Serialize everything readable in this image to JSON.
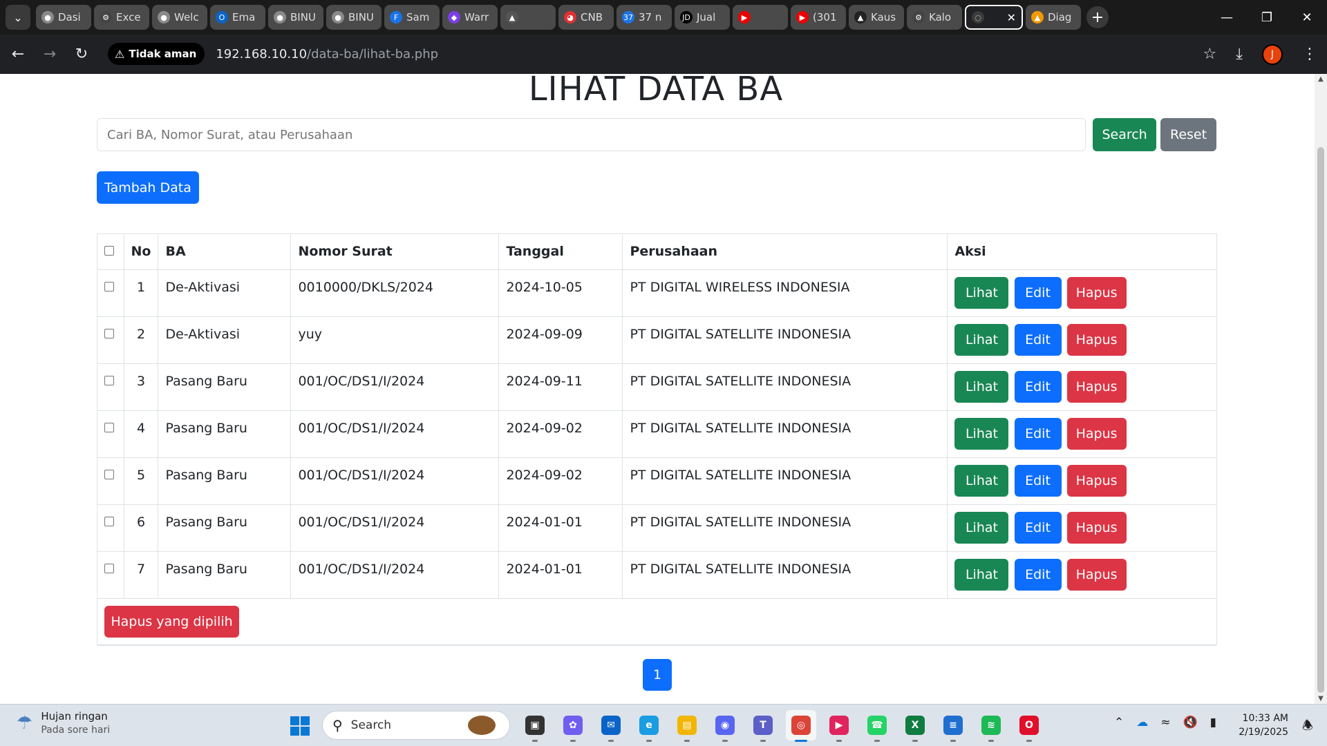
{
  "browser": {
    "tabs": [
      {
        "label": "Dasi",
        "color": "#8a8a8a",
        "glyph": "●"
      },
      {
        "label": "Exce",
        "color": "#444",
        "glyph": "⚙"
      },
      {
        "label": "Welc",
        "color": "#8a8a8a",
        "glyph": "●"
      },
      {
        "label": "Ema",
        "color": "#0a64c8",
        "glyph": "O"
      },
      {
        "label": "BINU",
        "color": "#8a8a8a",
        "glyph": "●"
      },
      {
        "label": "BINU",
        "color": "#8a8a8a",
        "glyph": "●"
      },
      {
        "label": "Sam",
        "color": "#1a73e8",
        "glyph": "F"
      },
      {
        "label": "Warr",
        "color": "#7b3fe4",
        "glyph": "◆"
      },
      {
        "label": "",
        "color": "#555",
        "glyph": "▲"
      },
      {
        "label": "CNB",
        "color": "#d33",
        "glyph": "◕"
      },
      {
        "label": "37 n",
        "color": "#1a73e8",
        "glyph": "37"
      },
      {
        "label": "Jual",
        "color": "#000",
        "glyph": "JD"
      },
      {
        "label": "",
        "color": "#e00",
        "glyph": "▶"
      },
      {
        "label": "(301",
        "color": "#e00",
        "glyph": "▶"
      },
      {
        "label": "Kaus",
        "color": "#222",
        "glyph": "▲"
      },
      {
        "label": "Kalo",
        "color": "#444",
        "glyph": "⚙"
      }
    ],
    "active_tab": {
      "label": "",
      "glyph": "◌"
    },
    "last_tab": {
      "label": "Diag",
      "color": "#f29900",
      "glyph": "▲"
    },
    "security_label": "Tidak aman",
    "url_host": "192.168.10.10",
    "url_path": "/data-ba/lihat-ba.php",
    "profile_initial": "J"
  },
  "page": {
    "title": "LIHAT DATA BA",
    "search": {
      "placeholder": "Cari BA, Nomor Surat, atau Perusahaan",
      "search_label": "Search",
      "reset_label": "Reset"
    },
    "add_label": "Tambah Data",
    "table": {
      "headers": {
        "no": "No",
        "ba": "BA",
        "nomor": "Nomor Surat",
        "tanggal": "Tanggal",
        "perusahaan": "Perusahaan",
        "aksi": "Aksi"
      },
      "rows": [
        {
          "no": "1",
          "ba": "De-Aktivasi",
          "nomor": "0010000/DKLS/2024",
          "tanggal": "2024-10-05",
          "perusahaan": "PT DIGITAL WIRELESS INDONESIA"
        },
        {
          "no": "2",
          "ba": "De-Aktivasi",
          "nomor": "yuy",
          "tanggal": "2024-09-09",
          "perusahaan": "PT DIGITAL SATELLITE INDONESIA"
        },
        {
          "no": "3",
          "ba": "Pasang Baru",
          "nomor": "001/OC/DS1/I/2024",
          "tanggal": "2024-09-11",
          "perusahaan": "PT DIGITAL SATELLITE INDONESIA"
        },
        {
          "no": "4",
          "ba": "Pasang Baru",
          "nomor": "001/OC/DS1/I/2024",
          "tanggal": "2024-09-02",
          "perusahaan": "PT DIGITAL SATELLITE INDONESIA"
        },
        {
          "no": "5",
          "ba": "Pasang Baru",
          "nomor": "001/OC/DS1/I/2024",
          "tanggal": "2024-09-02",
          "perusahaan": "PT DIGITAL SATELLITE INDONESIA"
        },
        {
          "no": "6",
          "ba": "Pasang Baru",
          "nomor": "001/OC/DS1/I/2024",
          "tanggal": "2024-01-01",
          "perusahaan": "PT DIGITAL SATELLITE INDONESIA"
        },
        {
          "no": "7",
          "ba": "Pasang Baru",
          "nomor": "001/OC/DS1/I/2024",
          "tanggal": "2024-01-01",
          "perusahaan": "PT DIGITAL SATELLITE INDONESIA"
        }
      ],
      "actions": {
        "lihat": "Lihat",
        "edit": "Edit",
        "hapus": "Hapus"
      },
      "bulk_delete_label": "Hapus yang dipilih"
    },
    "pagination": {
      "current": "1"
    }
  },
  "taskbar": {
    "weather": {
      "line1": "Hujan ringan",
      "line2": "Pada sore hari"
    },
    "search_label": "Search",
    "apps": [
      {
        "name": "task-view",
        "color": "#333",
        "glyph": "▣"
      },
      {
        "name": "copilot",
        "color": "#6f5ef0",
        "glyph": "✿"
      },
      {
        "name": "mail",
        "color": "#0a64c8",
        "glyph": "✉"
      },
      {
        "name": "edge",
        "color": "#1b9de2",
        "glyph": "e"
      },
      {
        "name": "file-explorer",
        "color": "#f2b500",
        "glyph": "▤"
      },
      {
        "name": "discord",
        "color": "#5865f2",
        "glyph": "◉"
      },
      {
        "name": "teams",
        "color": "#5b5fc7",
        "glyph": "T"
      },
      {
        "name": "chrome",
        "color": "#db4437",
        "glyph": "◎",
        "active": true
      },
      {
        "name": "media-player",
        "color": "#e0245e",
        "glyph": "▶"
      },
      {
        "name": "whatsapp",
        "color": "#25d366",
        "glyph": "☎"
      },
      {
        "name": "excel",
        "color": "#107c41",
        "glyph": "X"
      },
      {
        "name": "notepad",
        "color": "#1f6fd0",
        "glyph": "≡"
      },
      {
        "name": "spotify",
        "color": "#1db954",
        "glyph": "≋"
      },
      {
        "name": "opera",
        "color": "#e0102b",
        "glyph": "O"
      }
    ],
    "time": "10:33 AM",
    "date": "2/19/2025"
  }
}
